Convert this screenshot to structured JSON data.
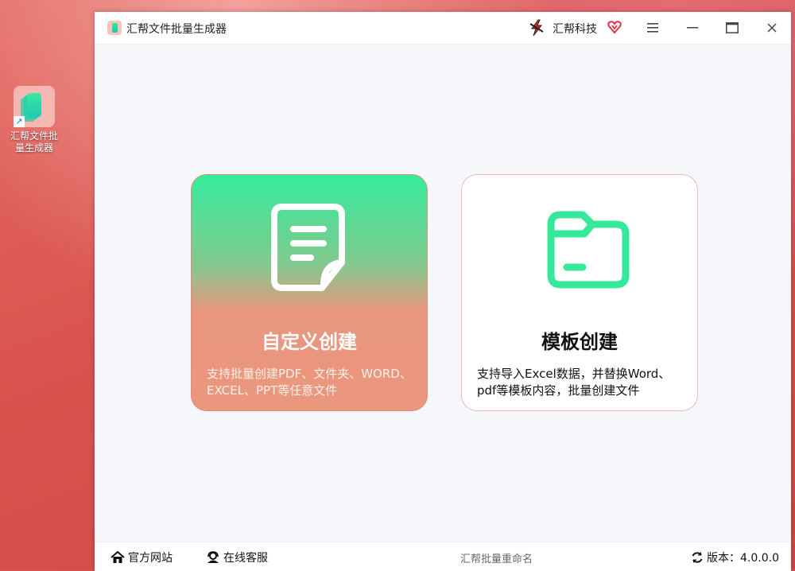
{
  "desktop": {
    "icon_label": "汇帮文件批\n量生成器",
    "shortcut_glyph": "↗"
  },
  "window": {
    "title": "汇帮文件批量生成器",
    "brand_name": "汇帮科技",
    "icons": {
      "menu": "menu-icon",
      "minimize": "minimize-icon",
      "maximize": "maximize-icon",
      "close": "close-icon"
    }
  },
  "cards": {
    "custom": {
      "title": "自定义创建",
      "desc": "支持批量创建PDF、文件夹、WORD、EXCEL、PPT等任意文件"
    },
    "template": {
      "title": "模板创建",
      "desc": "支持导入Excel数据，并替换Word、pdf等模板内容，批量创建文件"
    }
  },
  "statusbar": {
    "website": "官方网站",
    "service": "在线客服",
    "center": "汇帮批量重命名",
    "version": "版本：4.0.0.0"
  },
  "colors": {
    "accent_green": "#34ec9c",
    "card_salmon": "#ea977d",
    "desktop_red": "#d9534f",
    "vip_red": "#e0323c"
  }
}
